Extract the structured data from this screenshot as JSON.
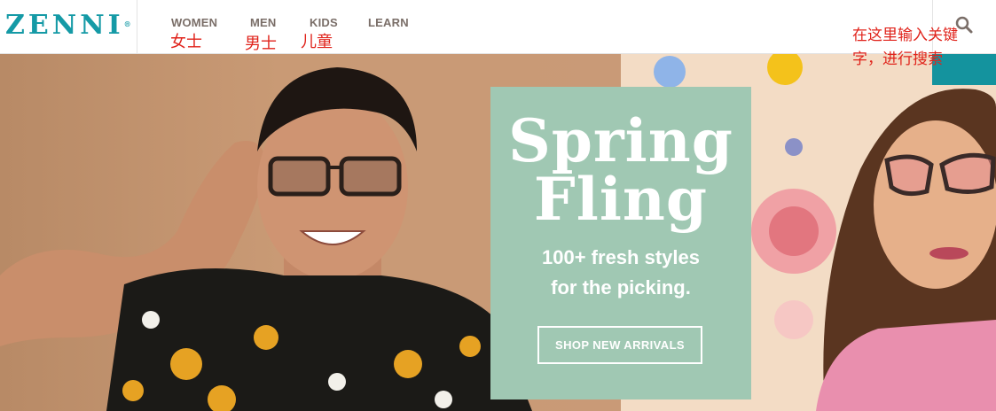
{
  "header": {
    "logo_text": "ZENNI",
    "logo_mark": "®",
    "nav": [
      {
        "label": "WOMEN",
        "note": "女士"
      },
      {
        "label": "MEN",
        "note": "男士"
      },
      {
        "label": "KIDS",
        "note": "儿童"
      },
      {
        "label": "LEARN"
      }
    ],
    "search_icon": "search-icon",
    "search_note": "在这里输入关键字，进行搜索"
  },
  "hero": {
    "promo": {
      "title_line1": "Spring",
      "title_line2": "Fling",
      "subtitle_line1": "100+ fresh styles",
      "subtitle_line2": "for the picking.",
      "button_label": "SHOP NEW ARRIVALS"
    }
  },
  "colors": {
    "brand": "#159aa6",
    "promo_bg": "#a0c8b3",
    "annotation_red": "#e0231b"
  }
}
